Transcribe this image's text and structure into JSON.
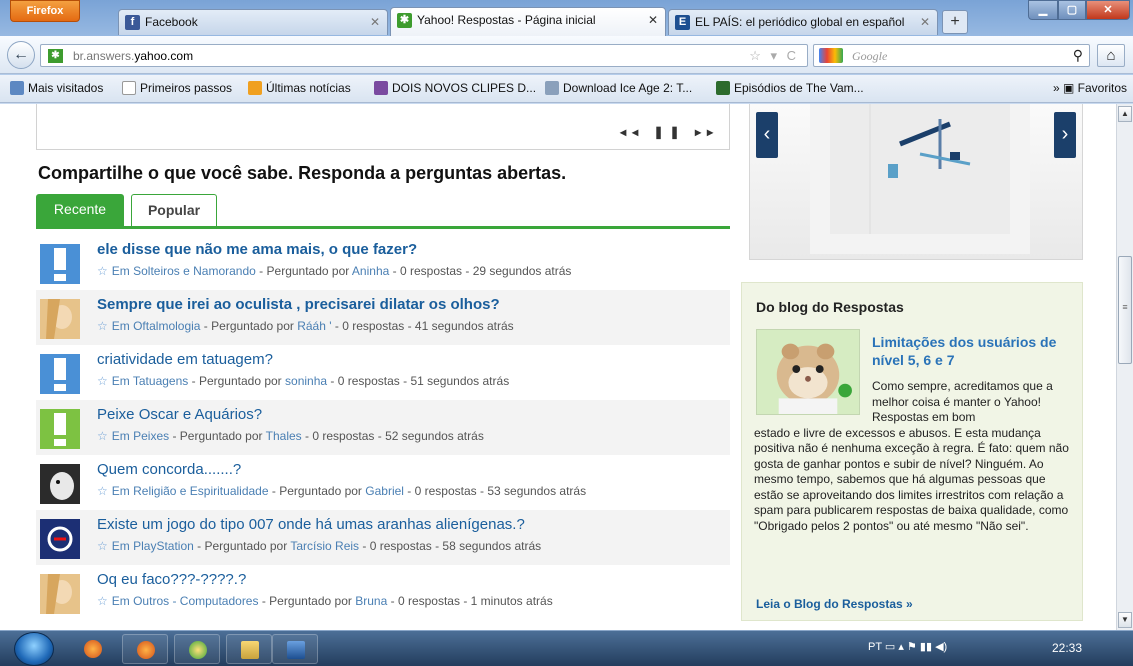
{
  "browser": {
    "menu_button": "Firefox",
    "tabs": [
      {
        "label": "Facebook",
        "icon_letter": "f",
        "icon_color": "#3b5998"
      },
      {
        "label": "Yahoo! Respostas - Página inicial",
        "icon_letter": "✱",
        "icon_color": "#3e9c2e"
      },
      {
        "label": "EL PAÍS: el periódico global en español",
        "icon_letter": "E",
        "icon_color": "#1d4f91"
      }
    ],
    "new_tab": "+",
    "url_domain_prefix": "br.answers.",
    "url_domain": "yahoo.com",
    "search_placeholder": "Google",
    "bookmarks": [
      {
        "label": "Mais visitados"
      },
      {
        "label": "Primeiros passos"
      },
      {
        "label": "Últimas notícias"
      },
      {
        "label": "DOIS NOVOS CLIPES D..."
      },
      {
        "label": "Download Ice Age 2: T..."
      },
      {
        "label": "Episódios de The Vam..."
      }
    ],
    "favorites": "Favoritos",
    "overflow": "»"
  },
  "page": {
    "headline": "Compartilhe o que você sabe. Responda a perguntas abertas.",
    "tabs": {
      "recent": "Recente",
      "popular": "Popular"
    },
    "questions": [
      {
        "title": "ele disse que não me ama mais, o que fazer?",
        "category": "Em Solteiros e Namorando",
        "author_prefix": "Perguntado por",
        "author": "Aninha",
        "answers": "0 respostas",
        "time": "29 segundos atrás",
        "thumb": "exclaim-blue"
      },
      {
        "title": "Sempre que irei ao oculista , precisarei dilatar os olhos?",
        "category": "Em Oftalmologia",
        "author_prefix": "Perguntado por",
        "author": "Rááh '",
        "answers": "0 respostas",
        "time": "41 segundos atrás",
        "thumb": "photo"
      },
      {
        "title": "criatividade em tatuagem?",
        "category": "Em Tatuagens",
        "author_prefix": "Perguntado por",
        "author": "soninha",
        "answers": "0 respostas",
        "time": "51 segundos atrás",
        "thumb": "exclaim-blue"
      },
      {
        "title": "Peixe Oscar e Aquários?",
        "category": "Em Peixes",
        "author_prefix": "Perguntado por",
        "author": "Thales",
        "answers": "0 respostas",
        "time": "52 segundos atrás",
        "thumb": "exclaim-green"
      },
      {
        "title": "Quem concorda.......?",
        "category": "Em Religião e Espiritualidade",
        "author_prefix": "Perguntado por",
        "author": "Gabriel",
        "answers": "0 respostas",
        "time": "53 segundos atrás",
        "thumb": "photo-dog"
      },
      {
        "title": "Existe um jogo do tipo 007 onde há umas aranhas alienígenas.?",
        "category": "Em PlayStation",
        "author_prefix": "Perguntado por",
        "author": "Tarcísio Reis",
        "answers": "0 respostas",
        "time": "58 segundos atrás",
        "thumb": "photo-logo"
      },
      {
        "title": "Oq eu faco???-????.?",
        "category": "Em Outros - Computadores",
        "author_prefix": "Perguntado por",
        "author": "Bruna",
        "answers": "0 respostas",
        "time": "1 minutos atrás",
        "thumb": "photo"
      }
    ],
    "promo": {
      "prev": "‹",
      "next": "›"
    },
    "blog": {
      "heading": "Do blog do Respostas",
      "title": "Limitações dos usuários de nível 5, 6 e 7",
      "intro": "Como sempre, acreditamos que a melhor coisa é manter o Yahoo! Respostas em bom",
      "body": "estado e livre de excessos e abusos. E esta mudança positiva não é nenhuma exceção à regra. É fato: quem não gosta de ganhar pontos e subir de nível? Ninguém. Ao mesmo tempo, sabemos que há algumas pessoas que estão se aproveitando dos limites irrestritos com relação a spam para publicarem respostas de baixa qualidade, como \"Obrigado pelos 2 pontos\" ou até mesmo \"Não sei\".",
      "link": "Leia o Blog do Respostas »"
    }
  },
  "taskbar": {
    "lang": "PT",
    "clock": "22:33"
  },
  "colors": {
    "accent_green": "#3aa63a",
    "link_blue": "#1a5e9c"
  }
}
